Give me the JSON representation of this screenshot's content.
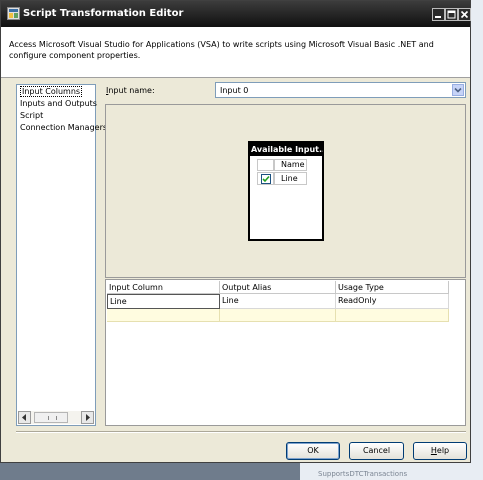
{
  "window": {
    "title": "Script Transformation Editor"
  },
  "header": {
    "description": "Access Microsoft Visual Studio for Applications (VSA) to write scripts using Microsoft Visual Basic .NET and configure component properties."
  },
  "nav": {
    "items": [
      "Input Columns",
      "Inputs and Outputs",
      "Script",
      "Connection Managers"
    ],
    "selected": "Input Columns"
  },
  "input_name": {
    "label_first": "I",
    "label_rest": "nput name:",
    "value": "Input 0"
  },
  "available_inputs": {
    "title": "Available Input...",
    "column_header": "Name",
    "rows": [
      {
        "name": "Line",
        "checked": true
      }
    ]
  },
  "grid": {
    "columns": [
      "Input Column",
      "Output Alias",
      "Usage Type"
    ],
    "rows": [
      {
        "input_column": "Line",
        "output_alias": "Line",
        "usage_type": "ReadOnly"
      }
    ]
  },
  "buttons": {
    "ok": "OK",
    "cancel": "Cancel",
    "help_first": "H",
    "help_rest": "elp"
  },
  "background": {
    "partial_text": "SupportsDTCTransactions"
  },
  "colors": {
    "titlebar": "#1a1a1a",
    "dialog": "#ece9d8",
    "new_row": "#fffce0",
    "check": "#21a121"
  }
}
